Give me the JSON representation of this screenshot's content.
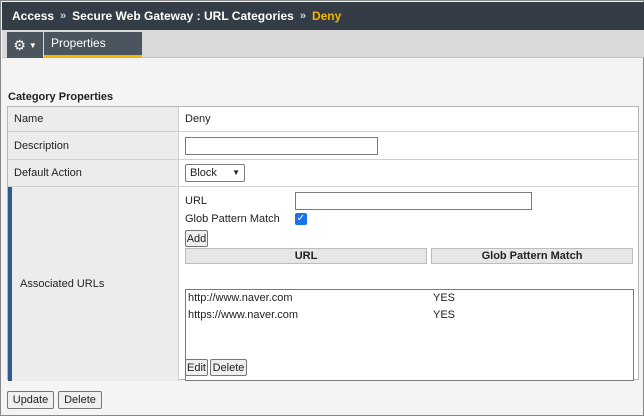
{
  "breadcrumb": {
    "items": [
      "Access",
      "Secure Web Gateway : URL Categories",
      "Deny"
    ],
    "separator": "»",
    "current_color": "#f5b400"
  },
  "tabs": {
    "gear_icon": "gear-icon",
    "properties_label": "Properties"
  },
  "section_title": "Category Properties",
  "form": {
    "name_label": "Name",
    "name_value": "Deny",
    "description_label": "Description",
    "description_value": "",
    "default_action_label": "Default Action",
    "default_action_value": "Block",
    "associated_urls_label": "Associated URLs",
    "url_label": "URL",
    "url_value": "",
    "glob_label": "Glob Pattern Match",
    "glob_checked": true,
    "add_button": "Add",
    "table_headers": [
      "URL",
      "Glob Pattern Match"
    ],
    "rows": [
      {
        "url": "http://www.naver.com",
        "glob": "YES"
      },
      {
        "url": "https://www.naver.com",
        "glob": "YES"
      }
    ],
    "edit_button": "Edit",
    "delete_button": "Delete"
  },
  "footer": {
    "update_button": "Update",
    "delete_button": "Delete"
  },
  "colors": {
    "header_bg": "#343d45",
    "accent": "#f5b400",
    "row_marker": "#2d5c8c"
  }
}
